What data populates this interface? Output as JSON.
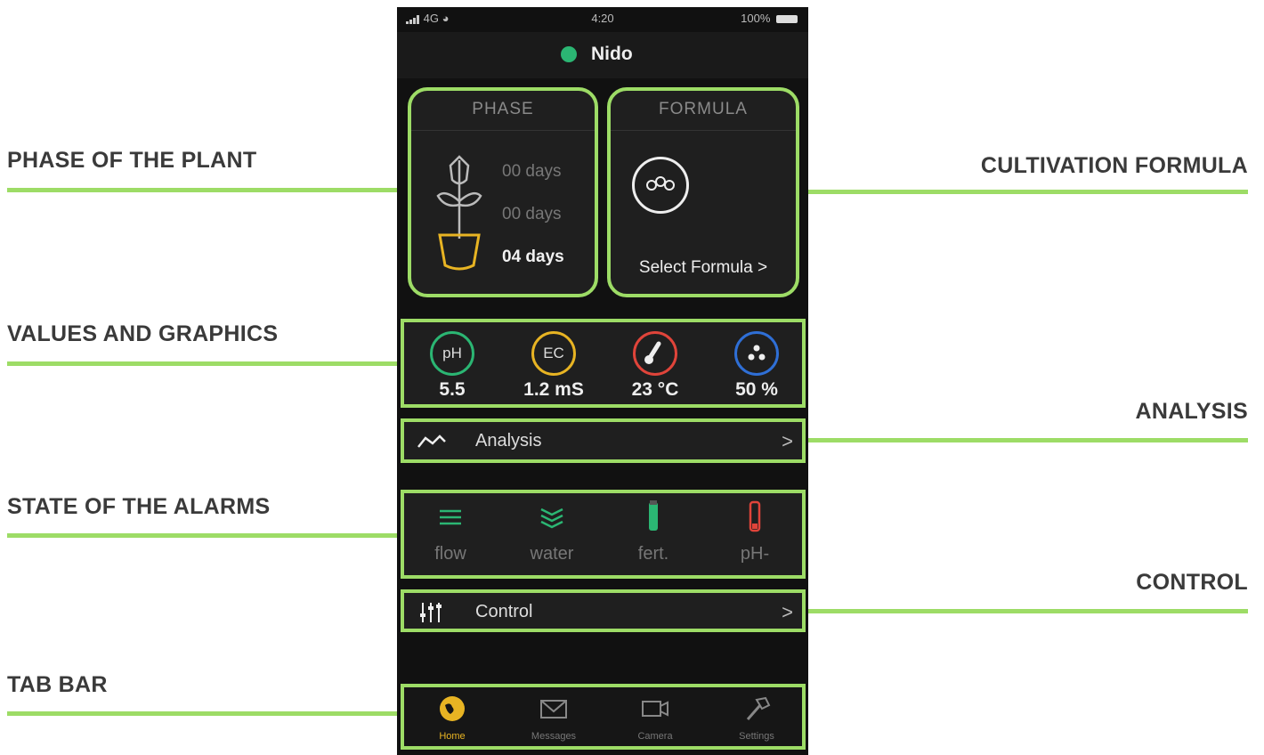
{
  "callouts": {
    "phase": "PHASE OF THE PLANT",
    "values": "VALUES AND GRAPHICS",
    "alarms": "STATE OF THE ALARMS",
    "tabbar": "TAB BAR",
    "formula": "CULTIVATION FORMULA",
    "analysis": "ANALYSIS",
    "control": "CONTROL"
  },
  "status_bar": {
    "signal": "4G",
    "time": "4:20",
    "battery": "100%"
  },
  "header": {
    "device_name": "Nido",
    "status_color": "#2bb673"
  },
  "phase": {
    "title": "PHASE",
    "days": [
      "00 days",
      "00 days",
      "04 days"
    ],
    "active_index": 2
  },
  "formula": {
    "title": "FORMULA",
    "link": "Select Formula >"
  },
  "values": [
    {
      "symbol": "pH",
      "value": "5.5",
      "color": "#2bb673"
    },
    {
      "symbol": "EC",
      "value": "1.2 mS",
      "color": "#e8b423"
    },
    {
      "symbol": "thermometer-icon",
      "value": "23 °C",
      "color": "#e0443a"
    },
    {
      "symbol": "drops-icon",
      "value": "50 %",
      "color": "#2f6fd6"
    }
  ],
  "analysis": {
    "label": "Analysis",
    "chevron": ">"
  },
  "alarms": [
    {
      "label": "flow",
      "color": "#2bb673"
    },
    {
      "label": "water",
      "color": "#2bb673"
    },
    {
      "label": "fert.",
      "color": "#2bb673"
    },
    {
      "label": "pH-",
      "color": "#e0443a"
    }
  ],
  "control": {
    "label": "Control",
    "chevron": ">"
  },
  "tabs": [
    {
      "label": "Home",
      "active": true
    },
    {
      "label": "Messages",
      "active": false
    },
    {
      "label": "Camera",
      "active": false
    },
    {
      "label": "Settings",
      "active": false
    }
  ],
  "colors": {
    "accent": "#9ddc66",
    "active_tab": "#e8b423"
  }
}
